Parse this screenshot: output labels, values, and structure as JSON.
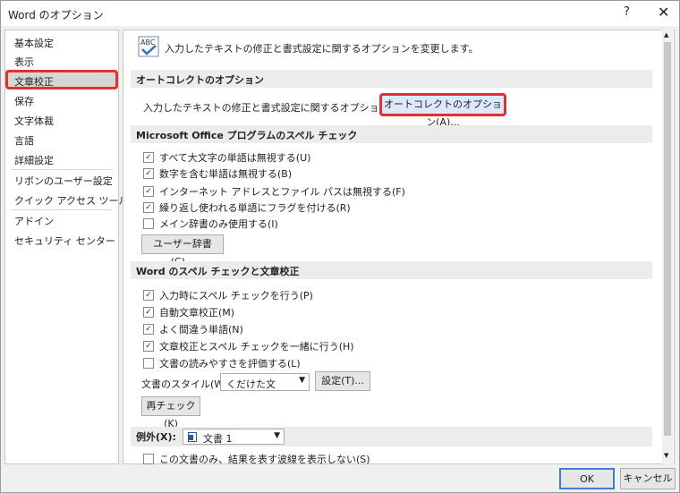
{
  "window": {
    "title": "Word のオプション",
    "help": "?",
    "close": "✕"
  },
  "sidebar": {
    "items": [
      "基本設定",
      "表示",
      "文章校正",
      "保存",
      "文字体裁",
      "言語",
      "詳細設定",
      "リボンのユーザー設定",
      "クイック アクセス ツール バー",
      "アドイン",
      "セキュリティ センター"
    ]
  },
  "main": {
    "header_text": "入力したテキストの修正と書式設定に関するオプションを変更します。",
    "autocorrect": {
      "section_title": "オートコレクトのオプション",
      "description": "入力したテキストの修正と書式設定に関するオプションを変更します。",
      "button": "オートコレクトのオプション(A)..."
    },
    "office_spell": {
      "section_title": "Microsoft Office プログラムのスペル チェック",
      "options": [
        {
          "label": "すべて大文字の単語は無視する(U)",
          "checked": true
        },
        {
          "label": "数字を含む単語は無視する(B)",
          "checked": true
        },
        {
          "label": "インターネット アドレスとファイル パスは無視する(F)",
          "checked": true
        },
        {
          "label": "繰り返し使われる単語にフラグを付ける(R)",
          "checked": true
        },
        {
          "label": "メイン辞書のみ使用する(I)",
          "checked": false
        }
      ],
      "dictionary_button": "ユーザー辞書(C)..."
    },
    "word_spell": {
      "section_title": "Word のスペル チェックと文章校正",
      "options": [
        {
          "label": "入力時にスペル チェックを行う(P)",
          "checked": true
        },
        {
          "label": "自動文章校正(M)",
          "checked": true
        },
        {
          "label": "よく間違う単語(N)",
          "checked": true
        },
        {
          "label": "文章校正とスペル チェックを一緒に行う(H)",
          "checked": true
        },
        {
          "label": "文書の読みやすさを評価する(L)",
          "checked": false
        }
      ],
      "style_label": "文書のスタイル(W):",
      "style_value": "くだけた文",
      "settings_button": "設定(T)...",
      "recheck_button": "再チェック(K)"
    },
    "exceptions": {
      "label": "例外(X):",
      "doc_value": "文書 1",
      "option": "この文書のみ、結果を表す波線を表示しない(S)"
    }
  },
  "footer": {
    "ok": "OK",
    "cancel": "キャンセル"
  }
}
